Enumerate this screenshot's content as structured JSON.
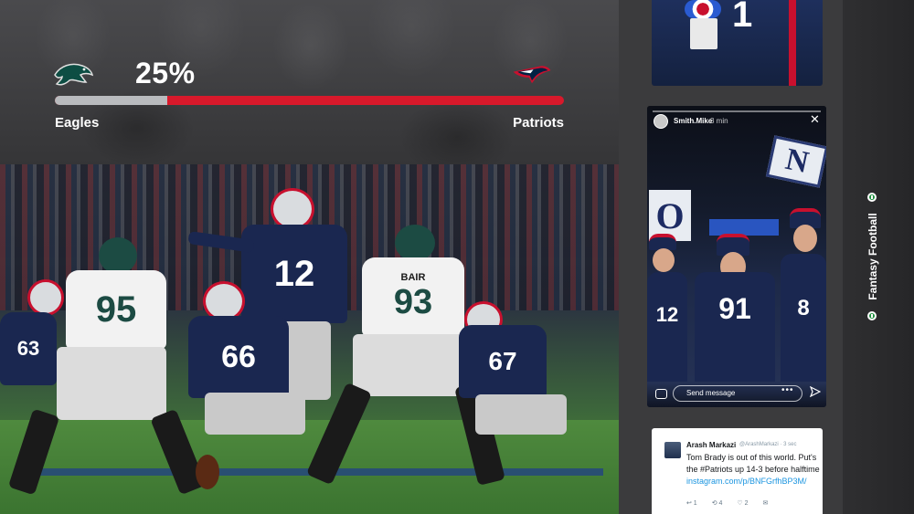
{
  "scoreboard": {
    "percentage": "25%",
    "percentage_value": 0.22,
    "left_team": "Eagles",
    "right_team": "Patriots",
    "left_color": "#b9bbbe",
    "right_color": "#d8192b"
  },
  "photo": {
    "jersey_numbers": [
      "95",
      "12",
      "93",
      "66",
      "67",
      "63",
      "BAIR"
    ]
  },
  "top_tile": {
    "number": "1"
  },
  "story": {
    "user": "Smith.Mike",
    "time": "3 min",
    "close_icon": "close-icon",
    "sign_n": "N",
    "sign_o": "O",
    "fan_numbers": [
      "91",
      "12",
      "8"
    ],
    "message_placeholder": "Send message",
    "more_icon": "more-icon",
    "send_icon": "send-icon"
  },
  "tweet": {
    "name": "Arash Markazi",
    "handle": "@ArashMarkazi · 3 sec",
    "text": "Tom Brady is out of this world. Put's the #Patriots up 14-3 before halftime ",
    "link": "instagram.com/p/BNFGrfhBP3M/",
    "actions": [
      "↩ 1",
      "⟲ 4",
      "♡ 2",
      "✉"
    ]
  },
  "sidebar": {
    "label": "Fantasy Football"
  },
  "colors": {
    "background": "#3a3a3c",
    "accent_red": "#d8192b",
    "patriots_navy": "#1a2750",
    "eagles_green": "#1e8e3e"
  }
}
